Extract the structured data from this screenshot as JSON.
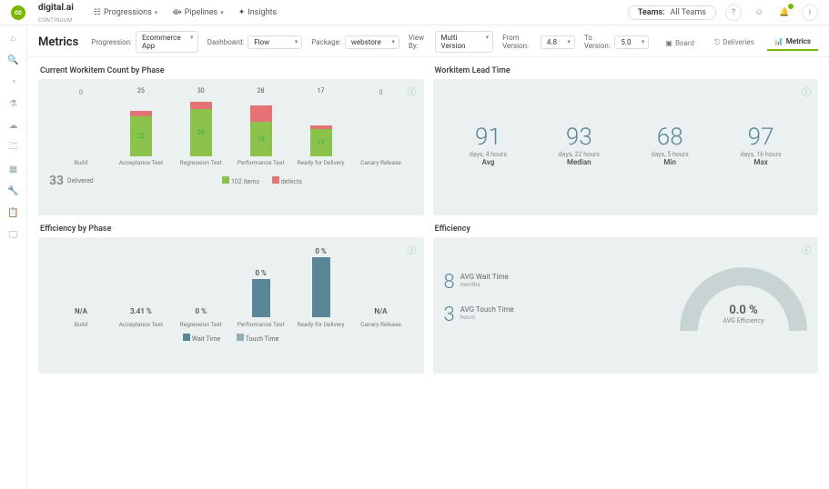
{
  "brand": {
    "name": "digital.ai",
    "sub": "CONTINUUM"
  },
  "topnav": {
    "progressions": "Progressions",
    "pipelines": "Pipelines",
    "insights": "Insights"
  },
  "teams": {
    "label": "Teams:",
    "value": "All Teams"
  },
  "page": {
    "title": "Metrics",
    "filters": {
      "progression_lbl": "Progression:",
      "progression_val": "Ecommerce App",
      "dashboard_lbl": "Dashboard:",
      "dashboard_val": "Flow",
      "package_lbl": "Package:",
      "package_val": "webstore",
      "viewby_lbl": "View By:",
      "viewby_val": "Multi Version",
      "fromv_lbl": "From Version:",
      "fromv_val": "4.8",
      "tov_lbl": "To Version:",
      "tov_val": "5.0"
    },
    "tabs": {
      "board": "Board",
      "deliveries": "Deliveries",
      "metrics": "Metrics"
    }
  },
  "panel1": {
    "title": "Current Workitem Count by Phase",
    "delivered_count": "33",
    "delivered_lbl": "Delivered",
    "legend_items": "items",
    "legend_items_count": "102",
    "legend_defects": "defects",
    "bars": [
      {
        "label": "Build",
        "total": "0",
        "green": 0,
        "red": 0
      },
      {
        "label": "Acceptance Test",
        "total": "25",
        "green": 22,
        "red": 3
      },
      {
        "label": "Regression Test",
        "total": "30",
        "green": 26,
        "red": 4
      },
      {
        "label": "Performance Test",
        "total": "28",
        "green": 19,
        "red": 9
      },
      {
        "label": "Ready for Delivery",
        "total": "17",
        "green": 15,
        "red": 2
      },
      {
        "label": "Canary Release",
        "total": "0",
        "green": 0,
        "red": 0
      }
    ]
  },
  "panel2": {
    "title": "Workitem Lead Time",
    "cols": [
      {
        "big": "91",
        "sub": "days, 4 hours",
        "stat": "Avg"
      },
      {
        "big": "93",
        "sub": "days, 22 hours",
        "stat": "Median"
      },
      {
        "big": "68",
        "sub": "days, 5 hours",
        "stat": "Min"
      },
      {
        "big": "97",
        "sub": "days, 16 hours",
        "stat": "Max"
      }
    ]
  },
  "panel3": {
    "title": "Efficiency by Phase",
    "legend_wait": "Wait Time",
    "legend_touch": "Touch Time",
    "cols": [
      {
        "label": "Build",
        "val": "N/A",
        "h": 0
      },
      {
        "label": "Acceptance Test",
        "val": "3.41 %",
        "h": 0
      },
      {
        "label": "Regression Test",
        "val": "0 %",
        "h": 0
      },
      {
        "label": "Performance Test",
        "val": "0 %",
        "h": 42
      },
      {
        "label": "Ready for Delivery",
        "val": "0 %",
        "h": 66
      },
      {
        "label": "Canary Release",
        "val": "N/A",
        "h": 0
      }
    ]
  },
  "panel4": {
    "title": "Efficiency",
    "wait_num": "8",
    "wait_lbl": "AVG Wait Time",
    "wait_unit": "months",
    "touch_num": "3",
    "touch_lbl": "AVG Touch Time",
    "touch_unit": "hours",
    "gauge_val": "0.0 %",
    "gauge_lbl": "AVG Efficiency"
  },
  "chart_data": [
    {
      "type": "bar",
      "title": "Current Workitem Count by Phase",
      "categories": [
        "Build",
        "Acceptance Test",
        "Regression Test",
        "Performance Test",
        "Ready for Delivery",
        "Canary Release"
      ],
      "series": [
        {
          "name": "items",
          "values": [
            0,
            22,
            26,
            19,
            15,
            0
          ]
        },
        {
          "name": "defects",
          "values": [
            0,
            3,
            4,
            9,
            2,
            0
          ]
        }
      ],
      "totals": [
        0,
        25,
        30,
        28,
        17,
        0
      ],
      "annotations": {
        "delivered": 33,
        "items_total": 102
      }
    },
    {
      "type": "table",
      "title": "Workitem Lead Time",
      "rows": [
        {
          "stat": "Avg",
          "days": 91,
          "hours": 4
        },
        {
          "stat": "Median",
          "days": 93,
          "hours": 22
        },
        {
          "stat": "Min",
          "days": 68,
          "hours": 5
        },
        {
          "stat": "Max",
          "days": 97,
          "hours": 16
        }
      ]
    },
    {
      "type": "bar",
      "title": "Efficiency by Phase",
      "categories": [
        "Build",
        "Acceptance Test",
        "Regression Test",
        "Performance Test",
        "Ready for Delivery",
        "Canary Release"
      ],
      "series": [
        {
          "name": "Wait Time",
          "values": [
            null,
            3.41,
            0,
            0,
            0,
            null
          ]
        },
        {
          "name": "Touch Time",
          "values": [
            null,
            null,
            null,
            null,
            null,
            null
          ]
        }
      ],
      "ylabel": "%"
    },
    {
      "type": "table",
      "title": "Efficiency",
      "rows": [
        {
          "metric": "AVG Wait Time",
          "value": 8,
          "unit": "months"
        },
        {
          "metric": "AVG Touch Time",
          "value": 3,
          "unit": "hours"
        },
        {
          "metric": "AVG Efficiency",
          "value": 0.0,
          "unit": "%"
        }
      ]
    }
  ]
}
